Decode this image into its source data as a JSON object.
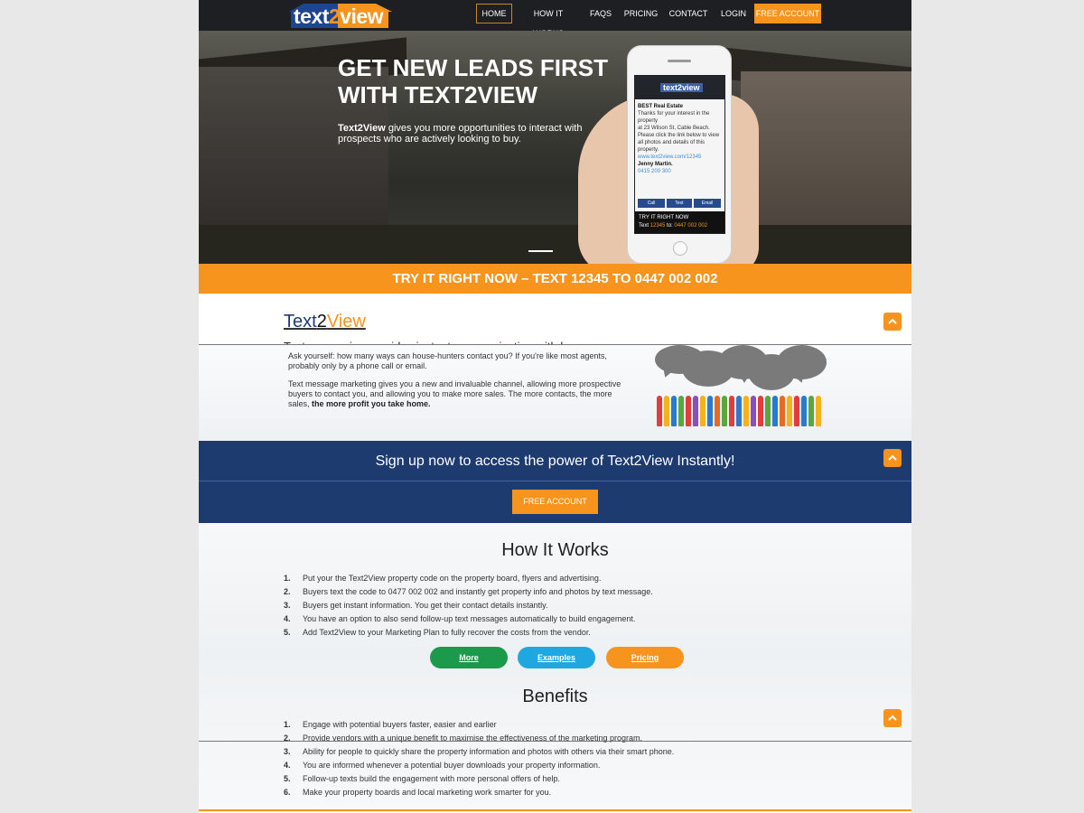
{
  "nav": {
    "logo_pre": "text",
    "logo_two": "2",
    "logo_post": "view",
    "items": [
      {
        "label": "HOME"
      },
      {
        "label": "HOW IT WORKS"
      },
      {
        "label": "FAQS"
      },
      {
        "label": "PRICING"
      },
      {
        "label": "CONTACT"
      },
      {
        "label": "LOGIN"
      },
      {
        "label": "FREE ACCOUNT"
      }
    ]
  },
  "hero": {
    "title_line1": "GET NEW LEADS FIRST",
    "title_line2": "WITH TEXT2VIEW",
    "sub_bold": "Text2View",
    "sub_rest": " gives you more opportunities to interact with prospects who are actively looking to buy."
  },
  "phone": {
    "logo": "text2view",
    "agency": "BEST Real Estate",
    "msg1": "Thanks for your interest in the property",
    "msg2": "at 23 Wilson St, Cable Beach.",
    "msg3": "Please click the link below to view all photos and details of this property.",
    "link_pre": "www.text2view.com/",
    "link_code": "12345",
    "agent": "Jenny Martin.",
    "agent_phone": "0415 200 300",
    "btn_call": "Call",
    "btn_text": "Text",
    "btn_email": "Email",
    "cta_title": "TRY IT RIGHT NOW",
    "cta_text": "Text ",
    "cta_code": "12345",
    "cta_to": " to: ",
    "cta_number": "0447 002 002"
  },
  "try_bar": "TRY IT RIGHT NOW – TEXT 12345 TO 0447 002 002",
  "intro": {
    "brand_a": "Text",
    "brand_b": "2",
    "brand_c": "View",
    "tagline": "Text messaging provides instant communication with buyers",
    "p1": "Ask yourself: how many ways can house-hunters contact you? If you're like most agents, probably only by a phone call or email.",
    "p2": "Text message marketing gives you a new and invaluable channel, allowing more prospective buyers to contact you, and allowing you to make more sales. The more contacts, the more sales, ",
    "p2_bold": "the more profit you take home."
  },
  "signup": {
    "title": "Sign up now to access the power of Text2View Instantly!",
    "button": "FREE ACCOUNT"
  },
  "how": {
    "title": "How It Works",
    "steps": [
      {
        "n": "1.",
        "text": "Put your the Text2View property code on the property board, flyers and advertising."
      },
      {
        "n": "2.",
        "text": "Buyers text the code to 0477 002 002 and instantly get property info and photos by text message."
      },
      {
        "n": "3.",
        "text": "Buyers get instant information. You get their contact details instantly."
      },
      {
        "n": "4.",
        "text": "You have an option to also send follow-up text messages automatically to build engagement."
      },
      {
        "n": "5.",
        "text": "Add Text2View to your Marketing Plan to fully recover the costs from the vendor."
      }
    ],
    "buttons": [
      {
        "label": "More",
        "color": "#1a9a4a"
      },
      {
        "label": "Examples",
        "color": "#1fa8e0"
      },
      {
        "label": "Pricing",
        "color": "#f7941d"
      }
    ]
  },
  "benefits": {
    "title": "Benefits",
    "items": [
      {
        "n": "1.",
        "text": "Engage with potential buyers faster, easier and earlier"
      },
      {
        "n": "2.",
        "text": "Provide vendors with a unique benefit to maximise the effectiveness of the marketing program."
      },
      {
        "n": "3.",
        "text": "Ability for people to quickly share the property information and photos with others via their smart phone."
      },
      {
        "n": "4.",
        "text": "You are informed whenever a potential buyer downloads your property information."
      },
      {
        "n": "5.",
        "text": "Follow-up texts build the engagement with more personal offers of help."
      },
      {
        "n": "6.",
        "text": "Make your property boards and local marketing work smarter for you."
      }
    ]
  },
  "colors": {
    "accent": "#f7941d",
    "navy": "#1e3b70",
    "nav_bg": "#1e1f22"
  },
  "icons": {
    "scroll_up": "chevron-up-icon"
  }
}
